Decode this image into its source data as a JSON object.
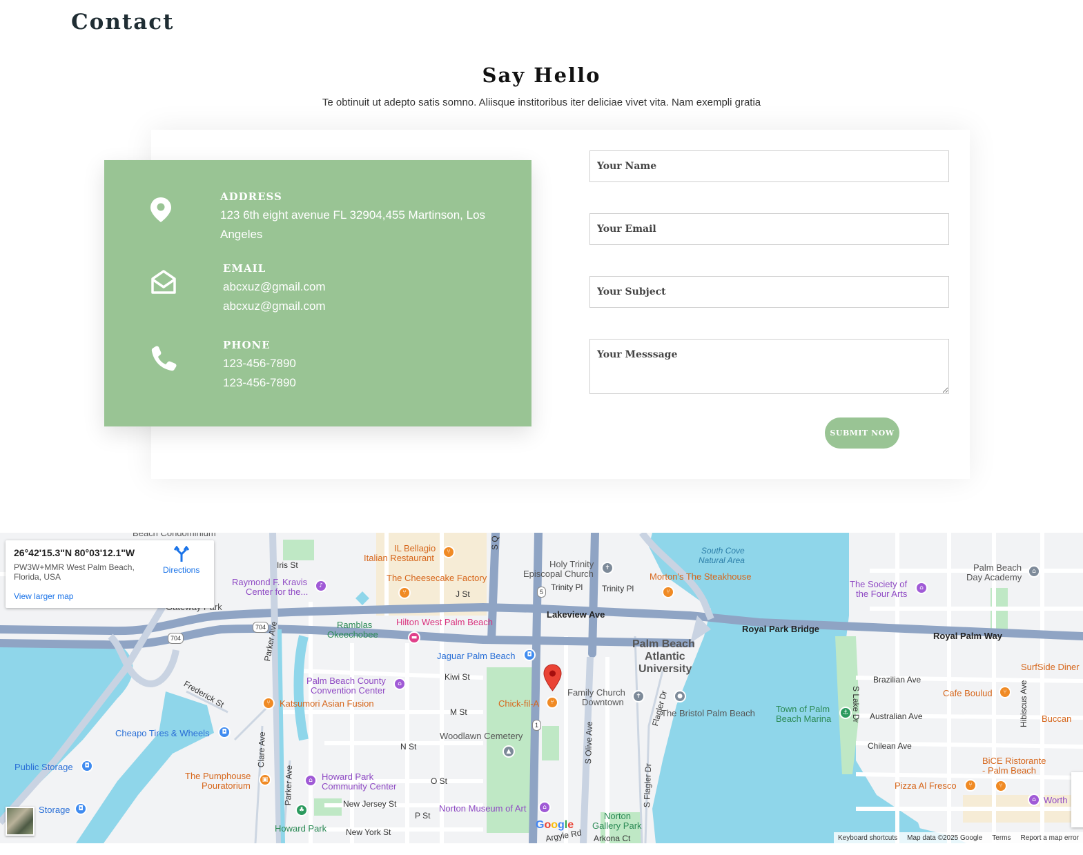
{
  "header": {
    "title": "Contact"
  },
  "section": {
    "heading": "Say Hello",
    "subtitle": "Te obtinuit ut adepto satis somno. Aliisque institoribus iter deliciae vivet vita. Nam exempli gratia"
  },
  "info": {
    "address": {
      "label": "ADDRESS",
      "line1": "123 6th eight avenue FL 32904,455 Martinson, Los",
      "line2": "Angeles",
      "icon": "map-pin-icon"
    },
    "email": {
      "label": "EMAIL",
      "line1": "abcxuz@gmail.com",
      "line2": "abcxuz@gmail.com",
      "icon": "envelope-open-icon"
    },
    "phone": {
      "label": "PHONE",
      "line1": "123-456-7890",
      "line2": "123-456-7890",
      "icon": "phone-icon"
    },
    "bg_color": "#99c494"
  },
  "form": {
    "name_placeholder": "Your Name",
    "email_placeholder": "Your Email",
    "subject_placeholder": "Your Subject",
    "message_placeholder": "Your Messsage",
    "submit_label": "SUBMIT NOW"
  },
  "map": {
    "info_card": {
      "coords": "26°42'15.3\"N 80°03'12.1\"W",
      "address": "PW3W+MMR West Palm Beach, Florida, USA",
      "view_larger": "View larger map",
      "directions": "Directions"
    },
    "labels": {
      "beach_condo": "Beach Condominium",
      "iris_st": "Iris St",
      "raymond_kravis": "Raymond F. Kravis",
      "raymond_kravis2": "Center for the...",
      "gateway_park": "Gateway Park",
      "il_bellagio": "IL Bellagio",
      "italian_restaurant": "Italian Restaurant",
      "cheesecake": "The Cheesecake Factory",
      "j_st": "J St",
      "holy_trinity": "Holy Trinity",
      "episcopal": "Episcopal Church",
      "trinity_pl": "Trinity Pl",
      "trinity_pl2": "Trinity Pl",
      "south_cove": "South Cove",
      "natural_area": "Natural Area",
      "mortons": "Morton's The Steakhouse",
      "society_four_arts": "The Society of",
      "society_four_arts2": "the Four Arts",
      "palm_beach_day": "Palm Beach",
      "palm_beach_day2": "Day Academy",
      "lakeview_ave": "Lakeview Ave",
      "royal_park_bridge": "Royal Park Bridge",
      "royal_palm_way": "Royal Palm Way",
      "ramblas": "Ramblas",
      "okeechobee": "Okeechobee",
      "hilton": "Hilton West Palm Beach",
      "jaguar": "Jaguar Palm Beach",
      "pba": "Palm Beach",
      "pba2": "Atlantic",
      "pba3": "University",
      "kiwi_st": "Kiwi St",
      "pbc_convention": "Palm Beach County",
      "pbc_convention2": "Convention Center",
      "parker_ave": "Parker Ave",
      "frederick_st": "Frederick St",
      "katsumori": "Katsumori Asian Fusion",
      "m_st": "M St",
      "chick_fil_a": "Chick-fil-A",
      "family_church": "Family Church",
      "family_church2": "Downtown",
      "bristol": "The Bristol Palm Beach",
      "town_palm_marina": "Town of Palm",
      "town_palm_marina2": "Beach Marina",
      "brazilian_ave": "Brazilian Ave",
      "cafe_boulud": "Cafe Boulud",
      "surfside": "SurfSide Diner",
      "australian_ave": "Australian Ave",
      "buccan": "Buccan",
      "cheapo": "Cheapo Tires & Wheels",
      "woodlawn": "Woodlawn Cemetery",
      "n_st": "N St",
      "chilean_ave": "Chilean Ave",
      "bice": "BiCE Ristorante",
      "bice2": "- Palm Beach",
      "public_storage": "Public Storage",
      "clare_ave": "Clare Ave",
      "pumphouse": "The Pumphouse",
      "pumphouse2": "Pouratorium",
      "howard_park_cc": "Howard Park",
      "howard_park_cc2": "Community Center",
      "o_st": "O St",
      "pizza_al_fresco": "Pizza Al Fresco",
      "worth": "Worth",
      "storage2": "Storage",
      "new_jersey": "New Jersey St",
      "norton_museum": "Norton Museum of Art",
      "p_st": "P St",
      "norton_gallery": "Norton",
      "norton_gallery2": "Gallery Park",
      "howard_park": "Howard Park",
      "new_york_st": "New York St",
      "argyle_rd": "Argyle Rd",
      "arkona_ct": "Arkona Ct",
      "s_olive_ave": "S Olive Ave",
      "s_flagler_dr": "S Flagler Dr",
      "s_lake_dr": "S Lake Dr",
      "hibiscus_ave": "Hibiscus Ave",
      "s_quadrille": "S Q",
      "flagler_dr2": "Flagler Dr",
      "shield_704": "704",
      "shield_704b": "704",
      "shield_5": "5",
      "shield_1": "1"
    },
    "footer": {
      "shortcuts": "Keyboard shortcuts",
      "map_data": "Map data ©2025 Google",
      "terms": "Terms",
      "report": "Report a map error"
    },
    "google": "Google",
    "colors": {
      "water": "#8fd6ea",
      "park": "#bfe8c5",
      "road_major": "#8fa4c4",
      "land": "#f2f3f5"
    }
  }
}
